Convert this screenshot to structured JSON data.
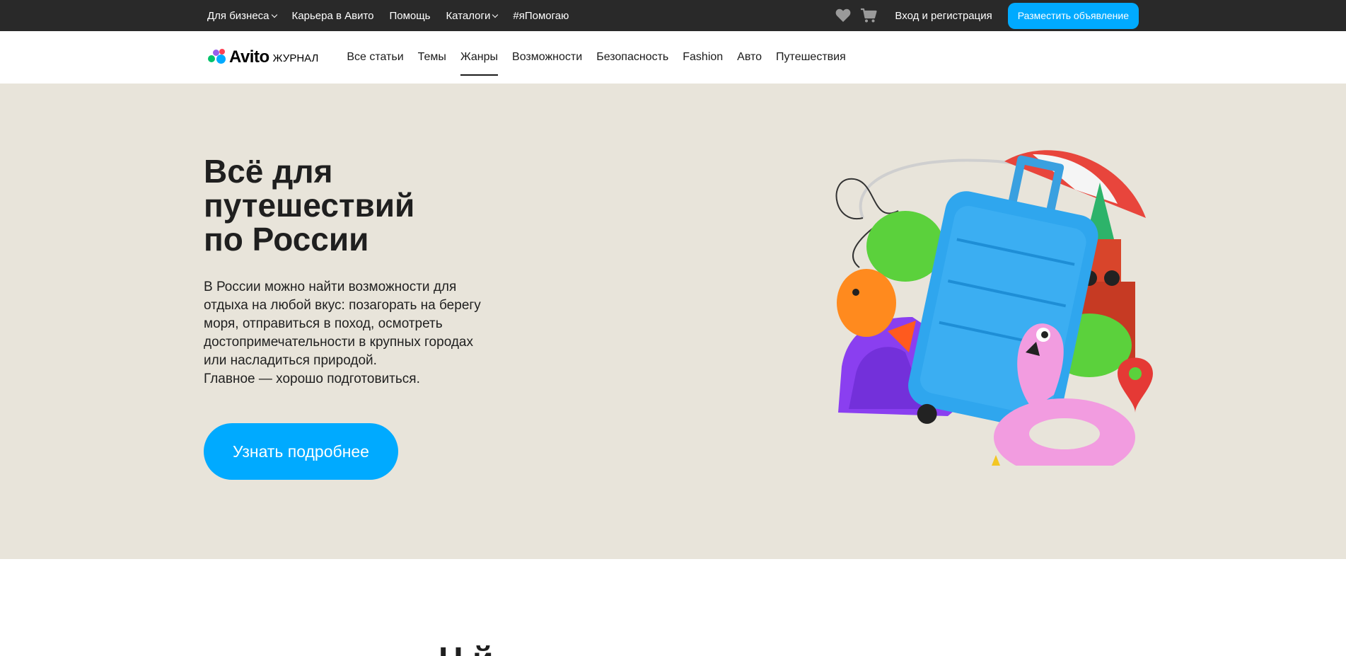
{
  "topbar": {
    "links": [
      {
        "label": "Для бизнеса",
        "dropdown": true
      },
      {
        "label": "Карьера в Авито",
        "dropdown": false
      },
      {
        "label": "Помощь",
        "dropdown": false
      },
      {
        "label": "Каталоги",
        "dropdown": true
      },
      {
        "label": "#яПомогаю",
        "dropdown": false
      }
    ],
    "favorites_icon": "heart-icon",
    "cart_icon": "cart-icon",
    "login_label": "Вход и регистрация",
    "post_ad_label": "Разместить объявление",
    "bg_color": "#292929",
    "accent_color": "#00aaff"
  },
  "nav": {
    "logo_word": "Avito",
    "logo_sub": "ЖУРНАЛ",
    "items": [
      {
        "label": "Все статьи",
        "active": false
      },
      {
        "label": "Темы",
        "active": false
      },
      {
        "label": "Жанры",
        "active": true
      },
      {
        "label": "Возможности",
        "active": false
      },
      {
        "label": "Безопасность",
        "active": false
      },
      {
        "label": "Fashion",
        "active": false
      },
      {
        "label": "Авто",
        "active": false
      },
      {
        "label": "Путешествия",
        "active": false
      }
    ]
  },
  "hero": {
    "title_lines": [
      "Всё для",
      "путешествий",
      "по России"
    ],
    "description": "В России можно найти возможности для\nотдыха на любой вкус: позагорать на берегу\nморя, отправиться в поход, осмотреть\nдостопримечательности в крупных городах\nили насладиться природой.\nГлавное — хорошо подготовиться.",
    "cta_label": "Узнать подробнее",
    "bg_color": "#e8e4da",
    "cta_color": "#00aaff"
  },
  "below": {
    "heading_partial": "Н                                    й"
  }
}
